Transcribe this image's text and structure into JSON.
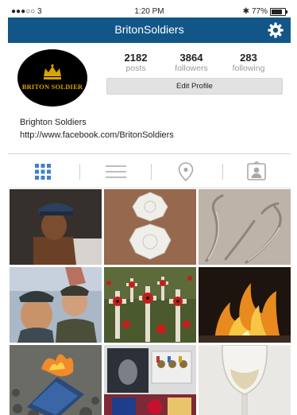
{
  "status_bar": {
    "carrier": "●●●○○ 3",
    "time": "1:20 PM",
    "battery": "77%",
    "battery_level": 0.77
  },
  "nav": {
    "title": "BritonSoldiers",
    "settings_icon": "gear-icon"
  },
  "profile": {
    "avatar_text": "BRITON SOLDIER",
    "stats": [
      {
        "value": "2182",
        "label": "posts"
      },
      {
        "value": "3864",
        "label": "followers"
      },
      {
        "value": "283",
        "label": "following"
      }
    ],
    "edit_button": "Edit Profile",
    "name": "Brighton Soldiers",
    "website": "http://www.facebook.com/BritonSoldiers"
  },
  "tabs": [
    {
      "icon": "grid-icon",
      "active": true
    },
    {
      "icon": "list-icon",
      "active": false
    },
    {
      "icon": "location-pin-icon",
      "active": false
    },
    {
      "icon": "tagged-person-icon",
      "active": false
    }
  ],
  "colors": {
    "nav_blue": "#125688",
    "active_tab": "#3f7fcf",
    "inactive_tab": "#a9a9a9"
  },
  "photos": [
    {
      "subject": "soldier bust figurine"
    },
    {
      "subject": "white sugar lace decoration"
    },
    {
      "subject": "metal leaf sculpture"
    },
    {
      "subject": "soldiers selfie"
    },
    {
      "subject": "poppy crosses field"
    },
    {
      "subject": "fire in fireplace"
    },
    {
      "subject": "burning box"
    },
    {
      "subject": "medals and magazines"
    },
    {
      "subject": "glass goblet"
    }
  ]
}
